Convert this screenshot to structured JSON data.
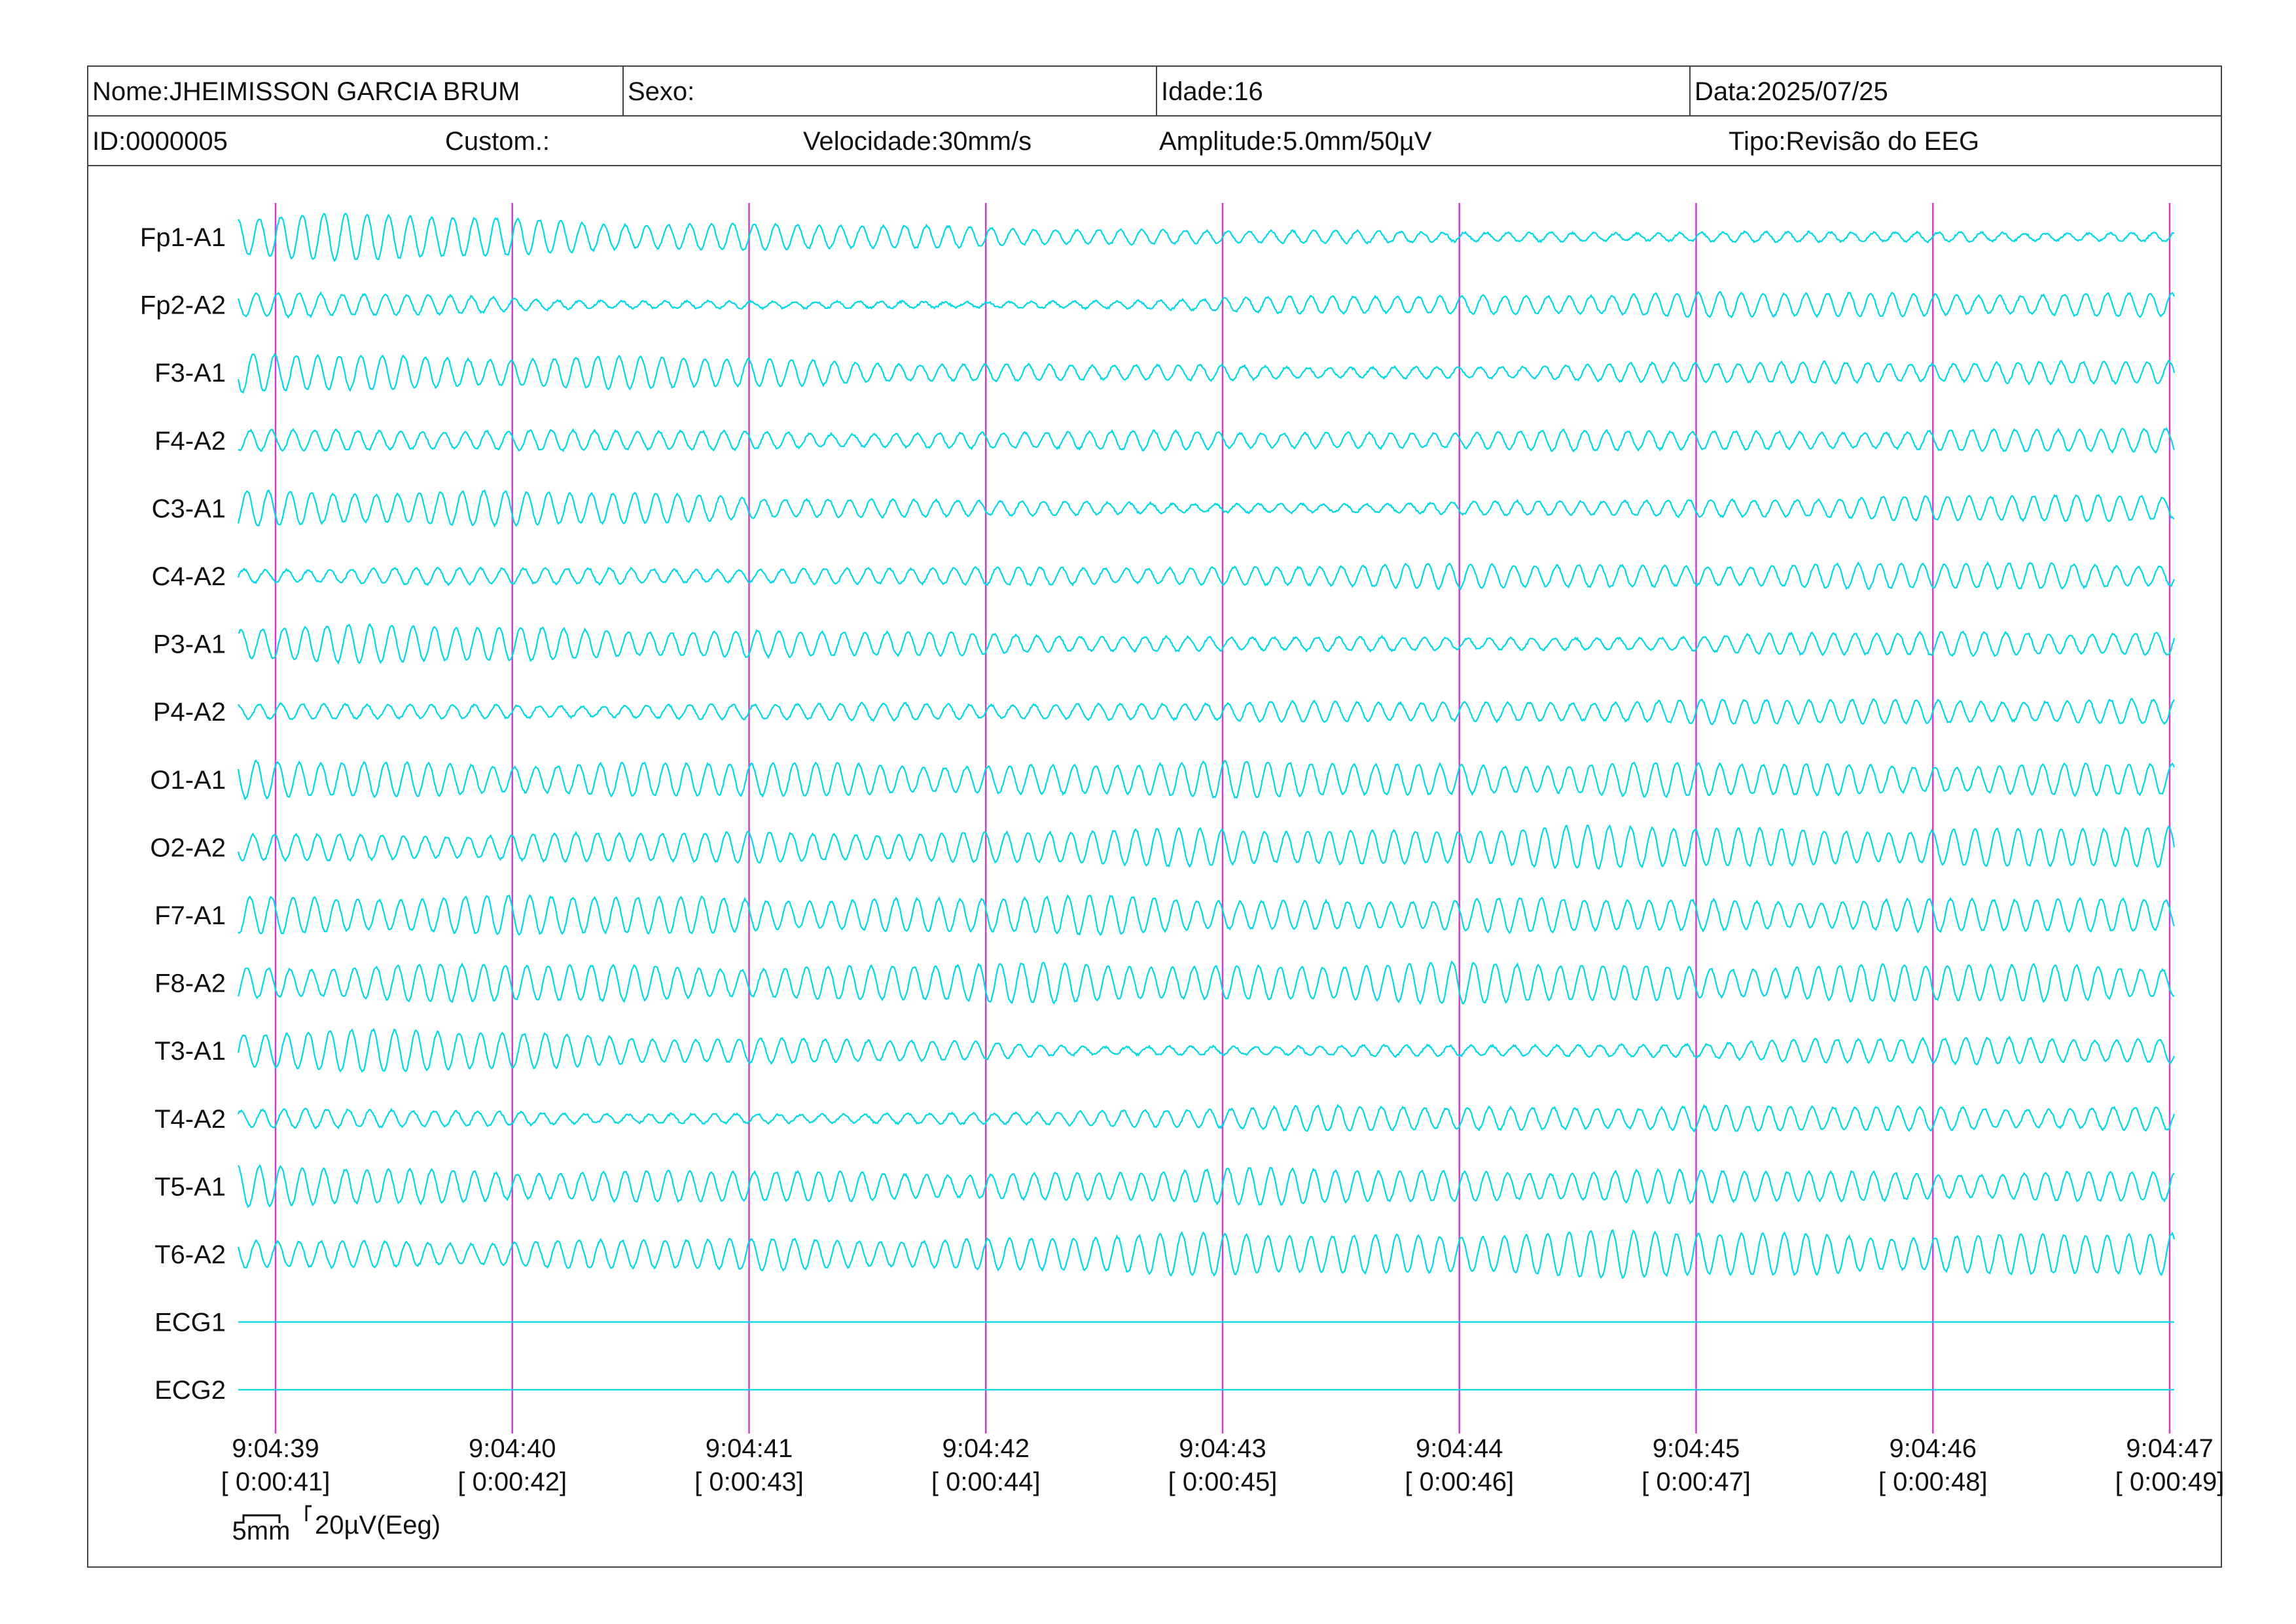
{
  "header": {
    "nome": "Nome:JHEIMISSON GARCIA BRUM",
    "sexo": "Sexo:",
    "idade": "Idade:16",
    "data": "Data:2025/07/25",
    "id": "ID:0000005",
    "custom": "Custom.:",
    "velocidade": "Velocidade:30mm/s",
    "amplitude": "Amplitude:5.0mm/50µV",
    "tipo": "Tipo:Revisão do EEG"
  },
  "colors": {
    "trace": "#00d8e6",
    "marker": "#d040d0",
    "text": "#111111"
  },
  "calibration": {
    "time_label": "5mm",
    "amp_label": "20µV(Eeg)"
  },
  "chart_data": {
    "type": "line",
    "title": "",
    "x_unit": "seconds",
    "x_range": [
      0,
      8.15
    ],
    "time_ticks": [
      {
        "x": 0,
        "clock": "9:04:39",
        "elapsed": "[ 0:00:41]"
      },
      {
        "x": 1,
        "clock": "9:04:40",
        "elapsed": "[ 0:00:42]"
      },
      {
        "x": 2,
        "clock": "9:04:41",
        "elapsed": "[ 0:00:43]"
      },
      {
        "x": 3,
        "clock": "9:04:42",
        "elapsed": "[ 0:00:44]"
      },
      {
        "x": 4,
        "clock": "9:04:43",
        "elapsed": "[ 0:00:45]"
      },
      {
        "x": 5,
        "clock": "9:04:44",
        "elapsed": "[ 0:00:46]"
      },
      {
        "x": 6,
        "clock": "9:04:45",
        "elapsed": "[ 0:00:47]"
      },
      {
        "x": 7,
        "clock": "9:04:46",
        "elapsed": "[ 0:00:48]"
      },
      {
        "x": 8,
        "clock": "9:04:47",
        "elapsed": "[ 0:00:49]"
      }
    ],
    "frequency_hz": 11,
    "amplitude_unit": "µV",
    "series": [
      {
        "name": "Fp1-A1",
        "amplitudes_uV": [
          55,
          55,
          40,
          28,
          22,
          14,
          12,
          12,
          12
        ]
      },
      {
        "name": "Fp2-A2",
        "amplitudes_uV": [
          28,
          28,
          10,
          8,
          10,
          22,
          28,
          30,
          30
        ]
      },
      {
        "name": "F3-A1",
        "amplitudes_uV": [
          50,
          45,
          40,
          28,
          20,
          14,
          20,
          28,
          28
        ]
      },
      {
        "name": "F4-A2",
        "amplitudes_uV": [
          28,
          28,
          24,
          20,
          22,
          22,
          24,
          24,
          28
        ]
      },
      {
        "name": "C3-A1",
        "amplitudes_uV": [
          50,
          45,
          38,
          25,
          14,
          12,
          18,
          28,
          32
        ]
      },
      {
        "name": "C4-A2",
        "amplitudes_uV": [
          20,
          20,
          20,
          20,
          22,
          28,
          30,
          30,
          32
        ]
      },
      {
        "name": "P3-A1",
        "amplitudes_uV": [
          45,
          45,
          40,
          30,
          22,
          16,
          16,
          26,
          32
        ]
      },
      {
        "name": "P4-A2",
        "amplitudes_uV": [
          18,
          18,
          18,
          20,
          22,
          24,
          28,
          30,
          32
        ]
      },
      {
        "name": "O1-A1",
        "amplitudes_uV": [
          45,
          45,
          42,
          40,
          40,
          45,
          40,
          40,
          40
        ]
      },
      {
        "name": "O2-A2",
        "amplitudes_uV": [
          35,
          35,
          35,
          40,
          42,
          48,
          50,
          50,
          48
        ]
      },
      {
        "name": "F7-A1",
        "amplitudes_uV": [
          50,
          50,
          45,
          45,
          45,
          40,
          40,
          42,
          40
        ]
      },
      {
        "name": "F8-A2",
        "amplitudes_uV": [
          45,
          45,
          45,
          45,
          48,
          48,
          48,
          45,
          45
        ]
      },
      {
        "name": "T3-A1",
        "amplitudes_uV": [
          55,
          50,
          40,
          28,
          12,
          12,
          15,
          28,
          35
        ]
      },
      {
        "name": "T4-A2",
        "amplitudes_uV": [
          22,
          22,
          14,
          10,
          22,
          30,
          32,
          30,
          30
        ]
      },
      {
        "name": "T5-A1",
        "amplitudes_uV": [
          50,
          45,
          40,
          35,
          38,
          45,
          40,
          38,
          38
        ]
      },
      {
        "name": "T6-A2",
        "amplitudes_uV": [
          35,
          35,
          35,
          40,
          45,
          55,
          55,
          55,
          50
        ]
      },
      {
        "name": "ECG1",
        "amplitudes_uV": [
          0,
          0,
          0,
          0,
          0,
          0,
          0,
          0,
          0
        ]
      },
      {
        "name": "ECG2",
        "amplitudes_uV": [
          0,
          0,
          0,
          0,
          0,
          0,
          0,
          0,
          0
        ]
      }
    ]
  }
}
